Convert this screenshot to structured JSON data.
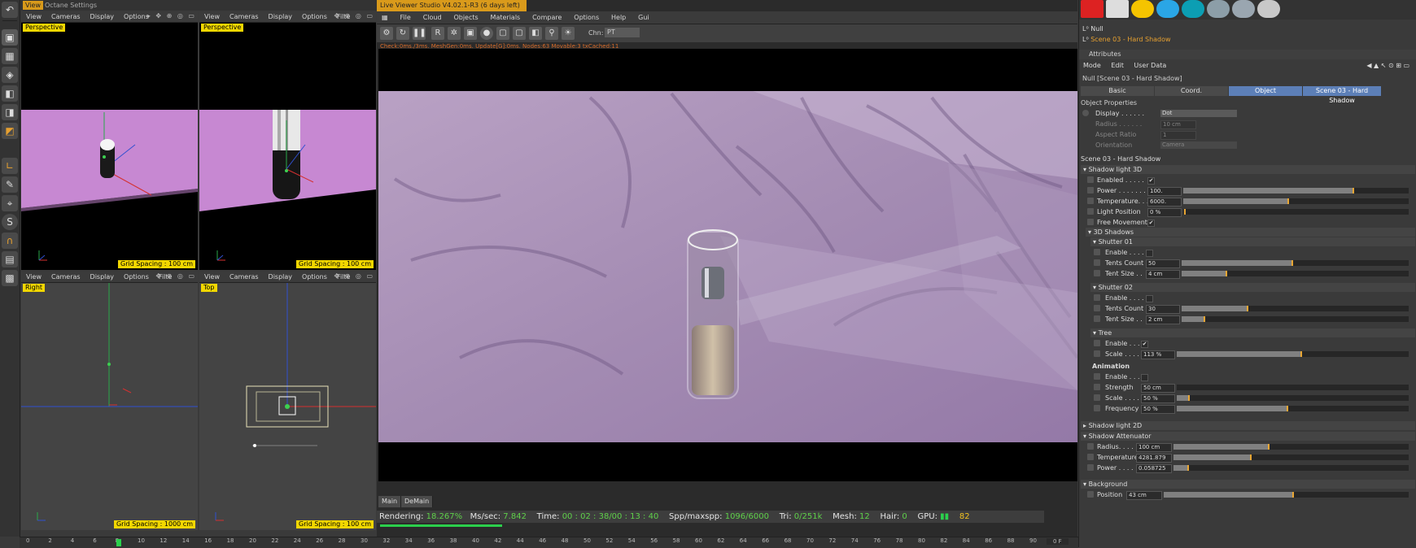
{
  "left_toolbar": {
    "icons": [
      "undo-icon",
      "cube-icon",
      "checker-icon",
      "grid-icon",
      "cube2-icon",
      "cube3-icon",
      "cube4-icon",
      "l-icon",
      "brush-icon",
      "cursor-icon",
      "s-icon",
      "magnet-icon",
      "lock-icon",
      "grid2-icon"
    ]
  },
  "top_tabs": {
    "view": "View",
    "octane": "Octane Settings"
  },
  "viewports": [
    {
      "label": "Perspective",
      "menu": [
        "View",
        "Cameras",
        "Display",
        "Options"
      ],
      "grid": "Grid Spacing : 100 cm"
    },
    {
      "label": "Perspective",
      "menu": [
        "View",
        "Cameras",
        "Display",
        "Options",
        "Filte"
      ],
      "grid": "Grid Spacing : 100 cm"
    },
    {
      "label": "Right",
      "menu": [
        "View",
        "Cameras",
        "Display",
        "Options",
        "Filte"
      ],
      "grid": "Grid Spacing : 1000 cm"
    },
    {
      "label": "Top",
      "menu": [
        "View",
        "Cameras",
        "Display",
        "Options",
        "Filte"
      ],
      "grid": "Grid Spacing : 100 cm"
    }
  ],
  "live_viewer": {
    "title": "Live Viewer Studio V4.02.1-R3 (6 days left)",
    "menu": [
      "File",
      "Cloud",
      "Objects",
      "Materials",
      "Compare",
      "Options",
      "Help",
      "Gui"
    ],
    "chn_label": "Chn:",
    "chn_value": "PT",
    "status": "Check:0ms./3ms. MeshGen:0ms. Update[G]:0ms. Nodes:63 Movable:3 txCached:11",
    "tabs": [
      "Main",
      "DeMain"
    ],
    "info": {
      "rendering_label": "Rendering:",
      "rendering_value": "18.267%",
      "ms_label": "Ms/sec:",
      "ms_value": "7.842",
      "time_label": "Time:",
      "time_value": "00 : 02 : 38/00 : 13 : 40",
      "spp_label": "Spp/maxspp:",
      "spp_value": "1096/6000",
      "tri_label": "Tri:",
      "tri_value": "0/251k",
      "mesh_label": "Mesh:",
      "mesh_value": "12",
      "hair_label": "Hair:",
      "hair_value": "0",
      "gpu_label": "GPU:",
      "gpu_value": "82"
    },
    "progress": 0.18267
  },
  "objects": [
    {
      "name": "Null"
    },
    {
      "name": "Scene 03 - Hard Shadow"
    }
  ],
  "attributes": {
    "title": "Attributes",
    "menu": [
      "Mode",
      "Edit",
      "User Data"
    ],
    "object_title": "Null [Scene 03 - Hard Shadow]",
    "tabs": [
      "Basic",
      "Coord.",
      "Object",
      "Scene 03 - Hard Shadow"
    ],
    "object_properties": "Object Properties",
    "display_label": "Display . . . . . .",
    "display_value": "Dot",
    "radius_label": "Radius . . . . . .",
    "radius_value": "10 cm",
    "aspect_label": "Aspect Ratio",
    "aspect_value": "1",
    "orient_label": "Orientation",
    "orient_value": "Camera",
    "scene_section": "Scene 03 - Hard Shadow",
    "sl3d": "Shadow light 3D",
    "enabled": "Enabled . . . . .",
    "power": "Power . . . . . . .",
    "power_value": "100.",
    "temp": "Temperature. . .",
    "temp_value": "6000.",
    "lightpos": "Light Position",
    "lightpos_value": "0 %",
    "freemove": "Free Movement",
    "shadows3d": "3D Shadows",
    "shutter01": "Shutter 01",
    "enable": "Enable . . . .",
    "tents": "Tents Count",
    "tents1_value": "50",
    "tents2_value": "30",
    "tentsize": "Tent Size . .",
    "tentsize1_value": "4 cm",
    "tentsize2_value": "2 cm",
    "shutter02": "Shutter 02",
    "tree": "Tree",
    "scale": "Scale . . . . .",
    "scale_value": "113 %",
    "animation": "Animation",
    "strength": "Strength",
    "strength_value": "50 cm",
    "ascale_value": "50 %",
    "frequency": "Frequency",
    "frequency_value": "50 %",
    "sl2d": "Shadow light 2D",
    "attenuator": "Shadow Attenuator",
    "aradius": "Radius. . . . .",
    "aradius_value": "100 cm",
    "atemp": "Temperature",
    "atemp_value": "4281.879",
    "apower": "Power . . . .",
    "apower_value": "0.058725",
    "background": "Background",
    "position": "Position",
    "position_value": "43 cm"
  },
  "timeline": {
    "ticks": [
      "0",
      "2",
      "4",
      "6",
      "8",
      "10",
      "12",
      "14",
      "16",
      "18",
      "20",
      "22",
      "24",
      "26",
      "28",
      "30",
      "32",
      "34",
      "36",
      "38",
      "40",
      "42",
      "44",
      "46",
      "48",
      "50",
      "52",
      "54",
      "56",
      "58",
      "60",
      "62",
      "64",
      "66",
      "68",
      "70",
      "72",
      "74",
      "76",
      "78",
      "80",
      "82",
      "84",
      "86",
      "88",
      "90"
    ],
    "frame": "0 F"
  },
  "colors": {
    "accent": "#d99a1b",
    "label_bg": "#f2d700",
    "progress": "#2bd04c",
    "tab_active": "#5c7fb7",
    "knob": "#e8a634"
  }
}
